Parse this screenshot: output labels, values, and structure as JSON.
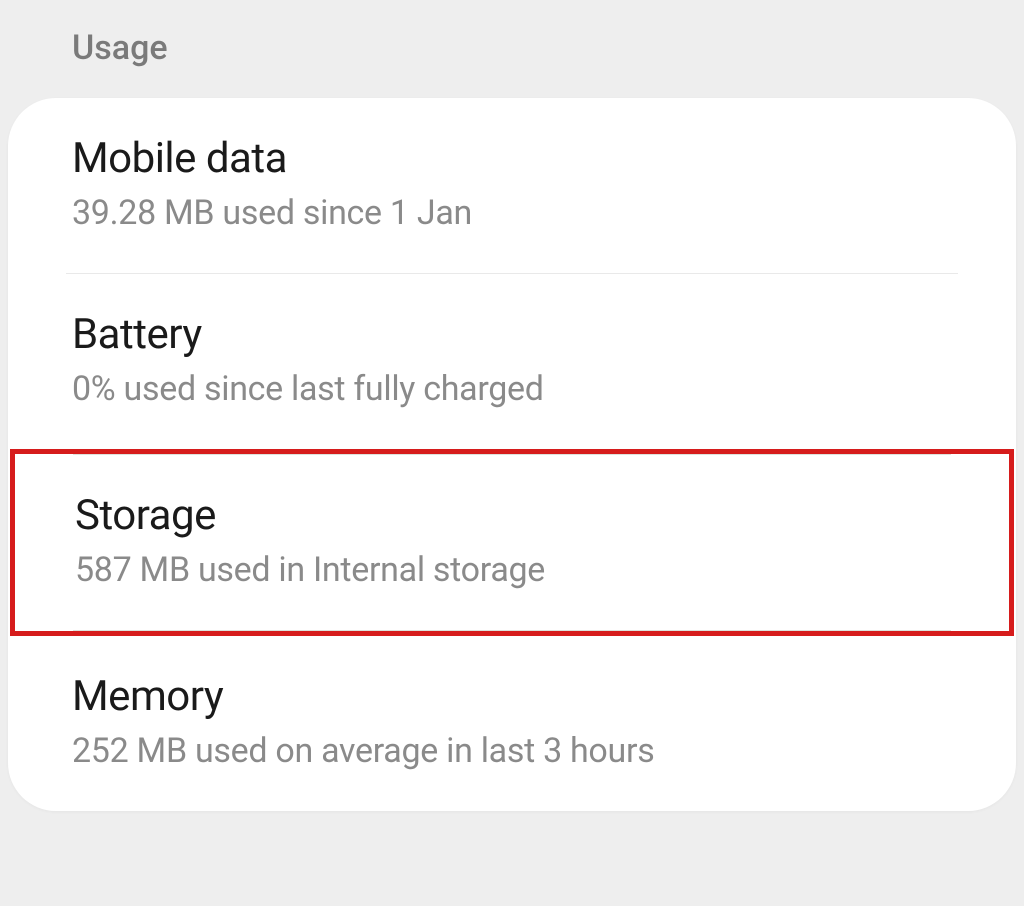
{
  "section": {
    "header": "Usage"
  },
  "items": {
    "mobile_data": {
      "title": "Mobile data",
      "subtitle": "39.28 MB used since 1 Jan"
    },
    "battery": {
      "title": "Battery",
      "subtitle": "0% used since last fully charged"
    },
    "storage": {
      "title": "Storage",
      "subtitle": "587 MB used in Internal storage"
    },
    "memory": {
      "title": "Memory",
      "subtitle": "252 MB used on average in last 3 hours"
    }
  }
}
